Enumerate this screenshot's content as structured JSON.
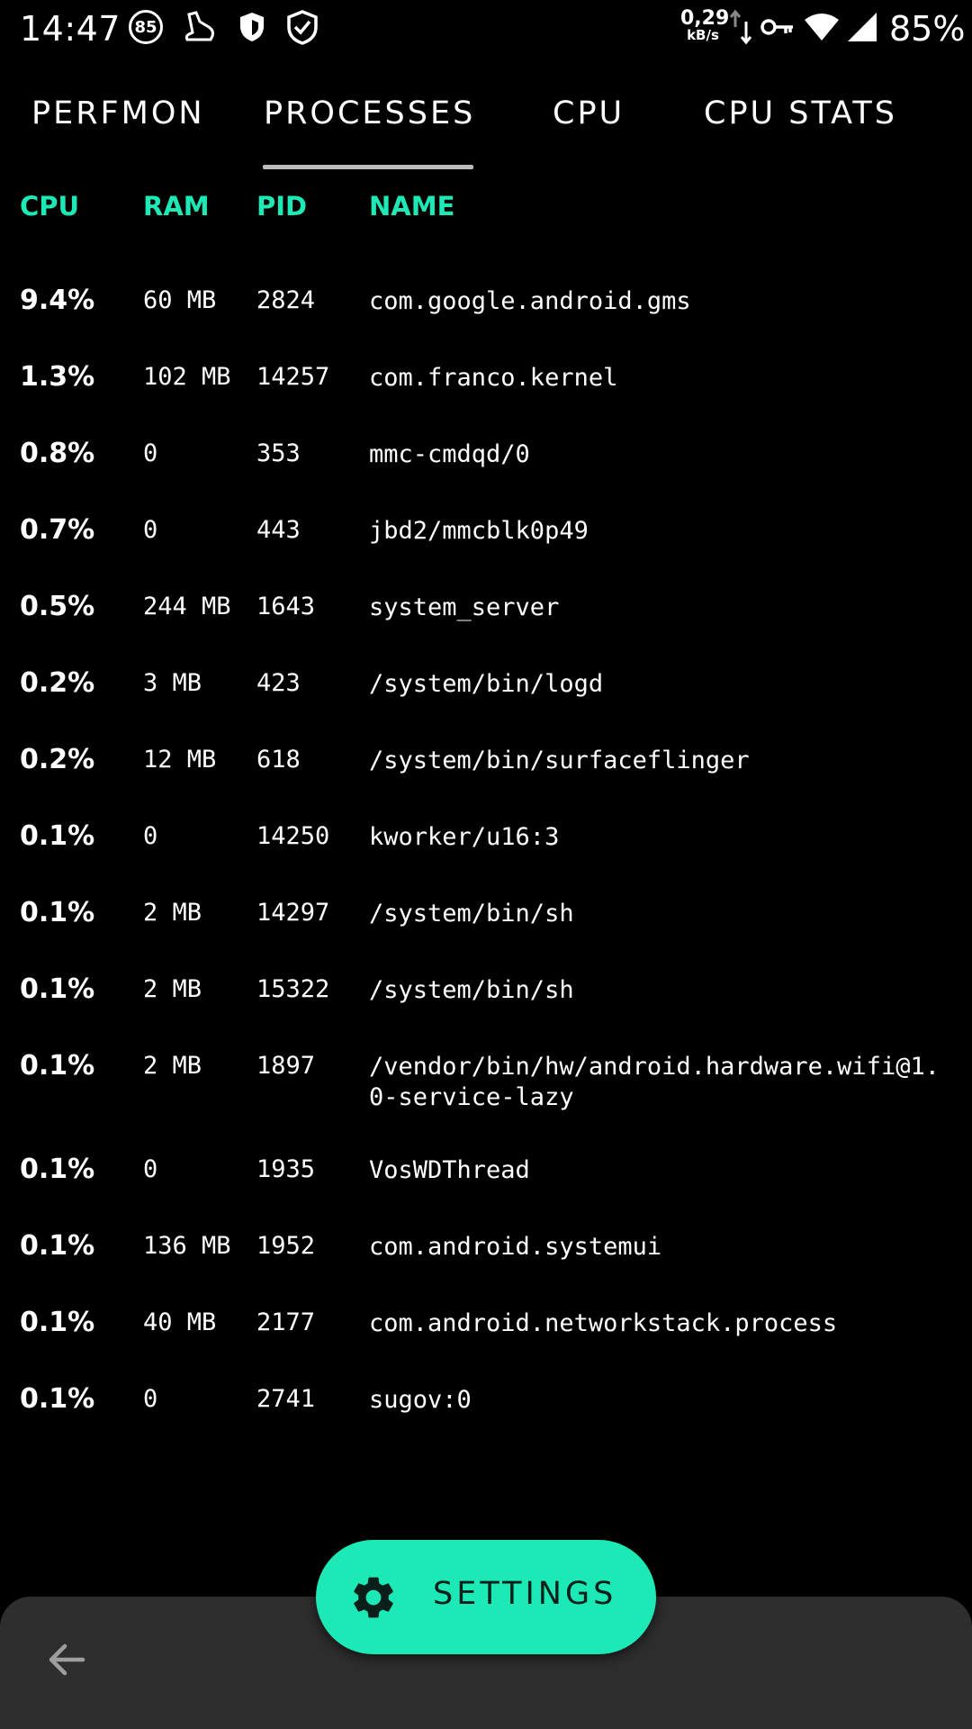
{
  "status_bar": {
    "time": "14:47",
    "notification_badge": "85",
    "net_speed_value": "0,29",
    "net_speed_unit": "kB/s",
    "battery": "85%",
    "icons": [
      "badge-85-icon",
      "shoe-icon",
      "shield-icon",
      "shield-check-icon",
      "updown-arrows-icon",
      "key-icon",
      "wifi-icon",
      "signal-icon"
    ]
  },
  "tabs": [
    {
      "label": "PERFMON"
    },
    {
      "label": "PROCESSES",
      "selected": true
    },
    {
      "label": "CPU"
    },
    {
      "label": "CPU STATS"
    }
  ],
  "columns": {
    "cpu": "CPU",
    "ram": "RAM",
    "pid": "PID",
    "name": "NAME"
  },
  "rows": [
    {
      "cpu": "9.4%",
      "ram": "60 MB",
      "pid": "2824",
      "name": "com.google.android.gms"
    },
    {
      "cpu": "1.3%",
      "ram": "102 MB",
      "pid": "14257",
      "name": "com.franco.kernel"
    },
    {
      "cpu": "0.8%",
      "ram": "0",
      "pid": "353",
      "name": "mmc-cmdqd/0"
    },
    {
      "cpu": "0.7%",
      "ram": "0",
      "pid": "443",
      "name": "jbd2/mmcblk0p49"
    },
    {
      "cpu": "0.5%",
      "ram": "244 MB",
      "pid": "1643",
      "name": "system_server"
    },
    {
      "cpu": "0.2%",
      "ram": "3 MB",
      "pid": "423",
      "name": "/system/bin/logd"
    },
    {
      "cpu": "0.2%",
      "ram": "12 MB",
      "pid": "618",
      "name": "/system/bin/surfaceflinger"
    },
    {
      "cpu": "0.1%",
      "ram": "0",
      "pid": "14250",
      "name": "kworker/u16:3"
    },
    {
      "cpu": "0.1%",
      "ram": "2 MB",
      "pid": "14297",
      "name": "/system/bin/sh"
    },
    {
      "cpu": "0.1%",
      "ram": "2 MB",
      "pid": "15322",
      "name": "/system/bin/sh"
    },
    {
      "cpu": "0.1%",
      "ram": "2 MB",
      "pid": "1897",
      "name": "/vendor/bin/hw/android.hardware.wifi@1.0-service-lazy"
    },
    {
      "cpu": "0.1%",
      "ram": "0",
      "pid": "1935",
      "name": "VosWDThread"
    },
    {
      "cpu": "0.1%",
      "ram": "136 MB",
      "pid": "1952",
      "name": "com.android.systemui"
    },
    {
      "cpu": "0.1%",
      "ram": "40 MB",
      "pid": "2177",
      "name": "com.android.networkstack.process"
    },
    {
      "cpu": "0.1%",
      "ram": "0",
      "pid": "2741",
      "name": "sugov:0"
    }
  ],
  "fab": {
    "label": "SETTINGS",
    "icon": "gear-icon"
  },
  "bottom_bar": {
    "back_icon": "back-arrow-icon"
  },
  "colors": {
    "accent": "#1de9b6",
    "background": "#000000",
    "bottom_bar": "#2e2e2e",
    "tab_indicator": "#bdbdbd"
  }
}
